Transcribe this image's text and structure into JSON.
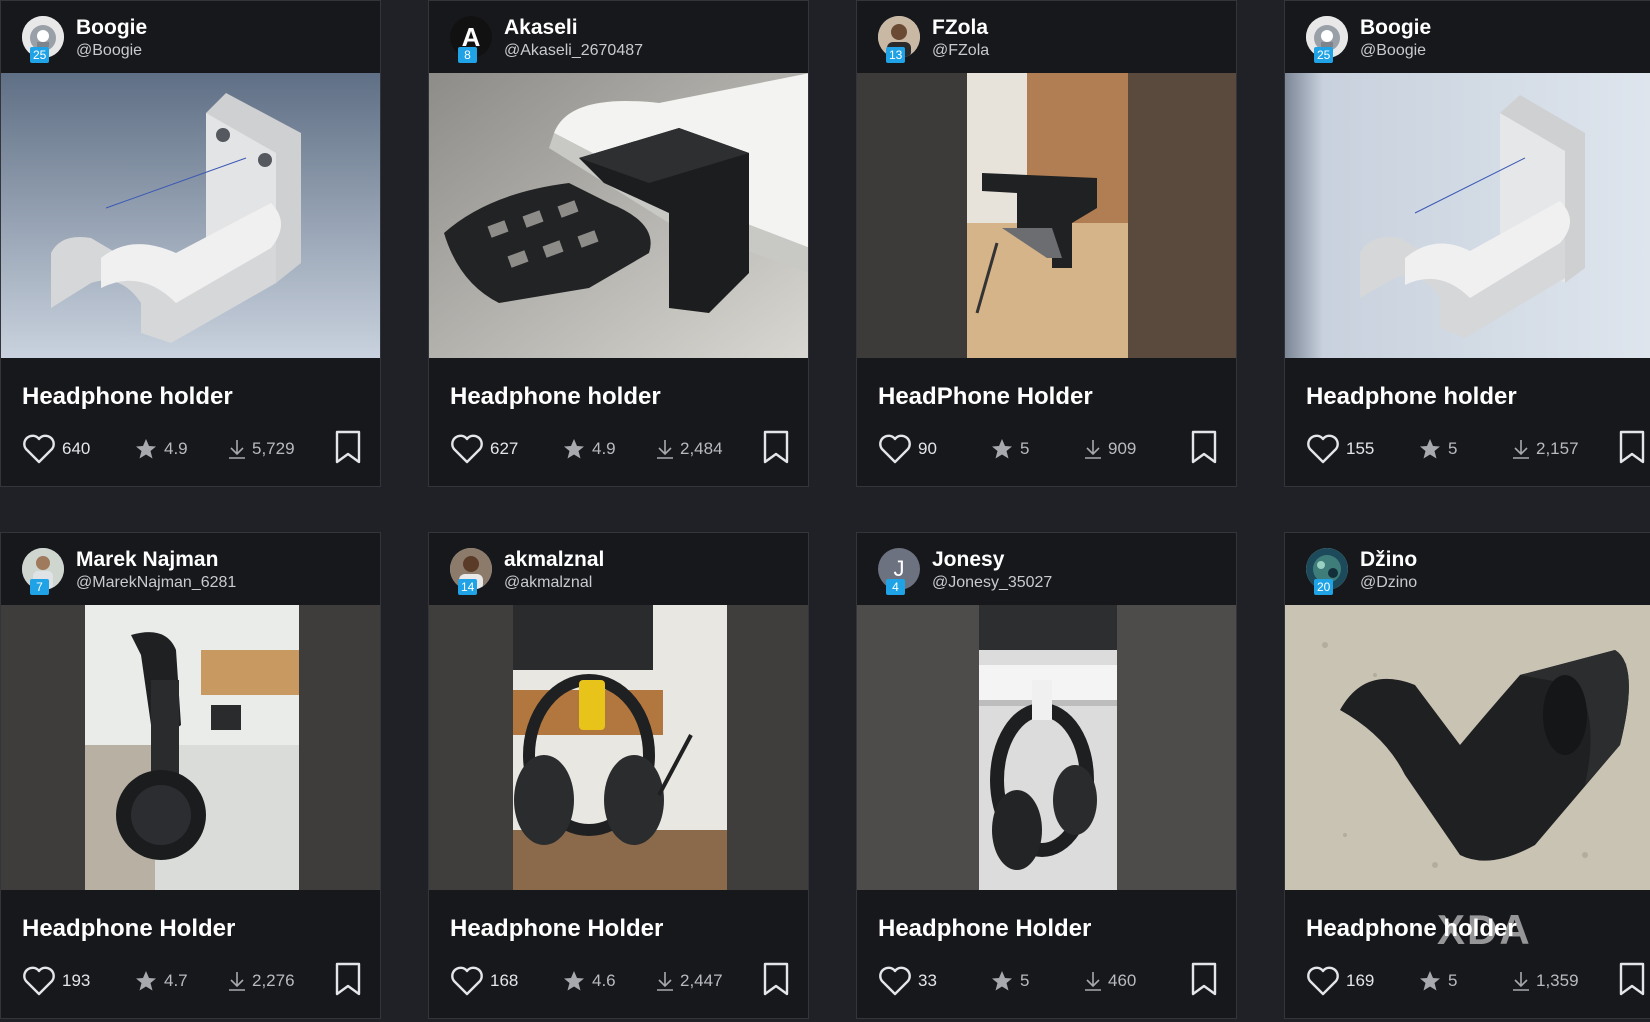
{
  "cards": [
    {
      "name": "Boogie",
      "handle": "@Boogie",
      "level": "25",
      "title": "Headphone holder",
      "likes": "640",
      "rating": "4.9",
      "downloads": "5,729"
    },
    {
      "name": "Akaseli",
      "handle": "@Akaseli_2670487",
      "level": "8",
      "title": "Headphone holder",
      "likes": "627",
      "rating": "4.9",
      "downloads": "2,484",
      "avatar_letter": "A"
    },
    {
      "name": "FZola",
      "handle": "@FZola",
      "level": "13",
      "title": "HeadPhone Holder",
      "likes": "90",
      "rating": "5",
      "downloads": "909"
    },
    {
      "name": "Boogie",
      "handle": "@Boogie",
      "level": "25",
      "title": "Headphone holder",
      "likes": "155",
      "rating": "5",
      "downloads": "2,157"
    },
    {
      "name": "Marek Najman",
      "handle": "@MarekNajman_6281",
      "level": "7",
      "title": "Headphone Holder",
      "likes": "193",
      "rating": "4.7",
      "downloads": "2,276"
    },
    {
      "name": "akmalznal",
      "handle": "@akmalznal",
      "level": "14",
      "title": "Headphone Holder",
      "likes": "168",
      "rating": "4.6",
      "downloads": "2,447"
    },
    {
      "name": "Jonesy",
      "handle": "@Jonesy_35027",
      "level": "4",
      "title": "Headphone Holder",
      "likes": "33",
      "rating": "5",
      "downloads": "460",
      "avatar_letter": "J"
    },
    {
      "name": "Džino",
      "handle": "@Dzino",
      "level": "20",
      "title": "Headphone holder",
      "likes": "169",
      "rating": "5",
      "downloads": "1,359"
    }
  ],
  "watermark": "XDA",
  "colors": {
    "background": "#202126",
    "card": "#17181c",
    "level_badge": "#1fa3e6"
  }
}
